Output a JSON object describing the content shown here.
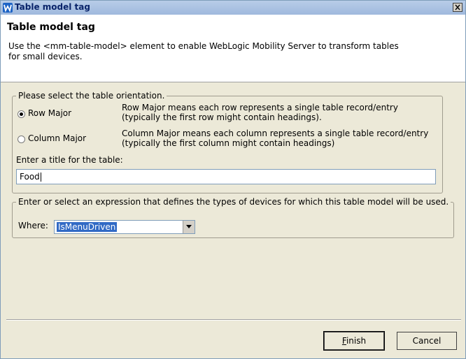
{
  "window": {
    "title": "Table model tag",
    "close_glyph": "x"
  },
  "header": {
    "title": "Table model tag",
    "description": "Use the <mm-table-model> element to enable WebLogic Mobility Server to transform tables\nfor small devices."
  },
  "orientation": {
    "legend": "Please select the table orientation.",
    "options": [
      {
        "label": "Row Major",
        "selected": true,
        "description": "Row Major means each row represents a single table record/entry\n(typically the first row might contain headings)."
      },
      {
        "label": "Column Major",
        "selected": false,
        "description": "Column Major means each column represents a single table record/entry\n(typically the first column might contain headings)"
      }
    ],
    "title_label": "Enter a title for the table:",
    "title_value": "Food"
  },
  "expression": {
    "legend": "Enter or select an expression that defines the types of devices for which this table model will be used.",
    "where_label": "Where:",
    "where_value": "IsMenuDriven"
  },
  "buttons": {
    "finish_mnemonic": "F",
    "finish_rest": "inish",
    "cancel": "Cancel"
  },
  "colors": {
    "titlebar": "#b8cde8",
    "dialog_bg": "#ece9d8",
    "selection": "#316ac5"
  }
}
